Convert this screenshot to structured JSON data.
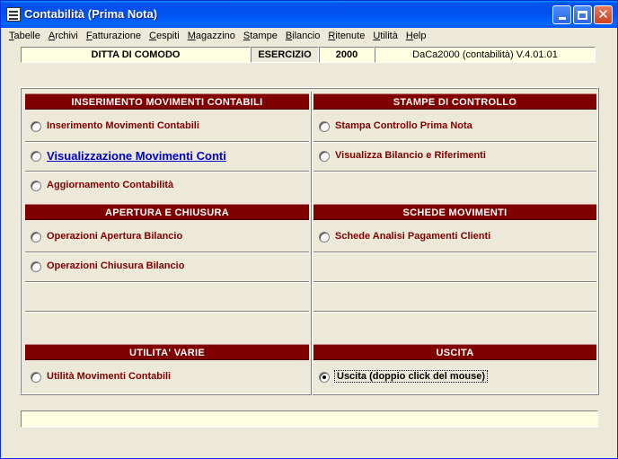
{
  "window": {
    "title": "Contabilità (Prima Nota)",
    "accent": "#0053ee",
    "section_color": "#800000"
  },
  "menu": {
    "items": [
      {
        "label": "Tabelle",
        "accel": "T",
        "rest": "abelle"
      },
      {
        "label": "Archivi",
        "accel": "A",
        "rest": "rchivi"
      },
      {
        "label": "Fatturazione",
        "accel": "F",
        "rest": "atturazione"
      },
      {
        "label": "Cespiti",
        "accel": "C",
        "rest": "espiti"
      },
      {
        "label": "Magazzino",
        "accel": "M",
        "rest": "agazzino"
      },
      {
        "label": "Stampe",
        "accel": "S",
        "rest": "tampe"
      },
      {
        "label": "Bilancio",
        "accel": "B",
        "rest": "ilancio"
      },
      {
        "label": "Ritenute",
        "accel": "R",
        "rest": "itenute"
      },
      {
        "label": "Utilità",
        "accel": "U",
        "rest": "tilità"
      },
      {
        "label": "Help",
        "accel": "H",
        "rest": "elp"
      }
    ]
  },
  "info": {
    "company": "DITTA DI COMODO",
    "year_label": "ESERCIZIO",
    "year": "2000",
    "version": "DaCa2000 (contabilità) V.4.01.01"
  },
  "sections": {
    "inserimento": {
      "title": "INSERIMENTO MOVIMENTI CONTABILI",
      "items": [
        "Inserimento Movimenti Contabili",
        "Visualizzazione Movimenti Conti",
        "Aggiornamento Contabilità"
      ]
    },
    "stampe": {
      "title": "STAMPE DI CONTROLLO",
      "items": [
        "Stampa Controllo Prima Nota",
        "Visualizza Bilancio e Riferimenti"
      ]
    },
    "apertura": {
      "title": "APERTURA E CHIUSURA",
      "items": [
        "Operazioni Apertura Bilancio",
        "Operazioni Chiusura Bilancio"
      ]
    },
    "schede": {
      "title": "SCHEDE MOVIMENTI",
      "items": [
        "Schede Analisi Pagamenti Clienti"
      ]
    },
    "utilita": {
      "title": "UTILITA' VARIE",
      "items": [
        "Utilità Movimenti Contabili"
      ]
    },
    "uscita": {
      "title": "USCITA",
      "items": [
        "Uscita (doppio click del mouse)"
      ]
    }
  },
  "status": {
    "text": ""
  }
}
